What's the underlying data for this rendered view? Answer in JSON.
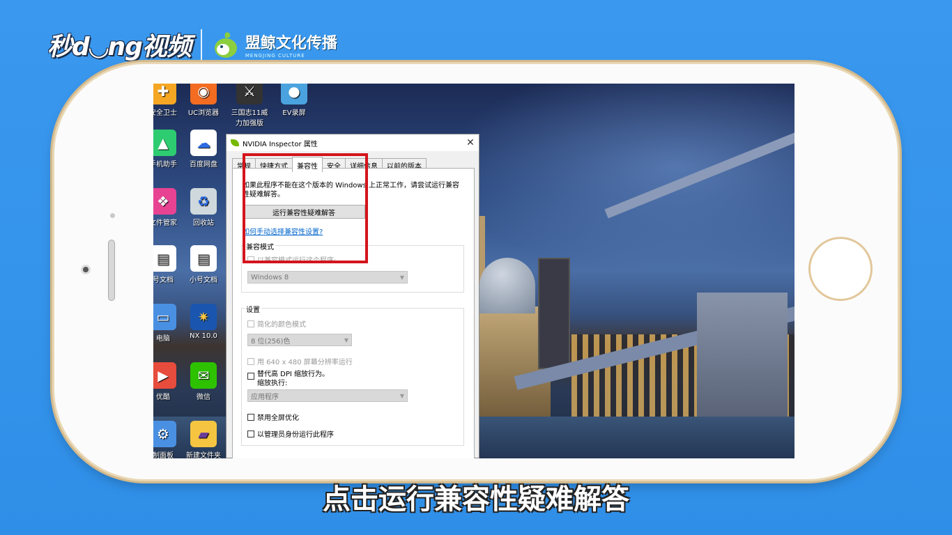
{
  "brand": {
    "logo_text": "秒d◡ng视频",
    "company_name": "盟鲸文化传播",
    "company_sub": "MENGJING CULTURE"
  },
  "desktop_icons": [
    {
      "label": "安全卫士",
      "icon": "shield-icon",
      "color": "#f5a623"
    },
    {
      "label": "UC浏览器",
      "icon": "uc-browser-icon",
      "color": "#f36c21"
    },
    {
      "label": "三国志11威力加强版",
      "icon": "game-pk-icon",
      "color": "#333333"
    },
    {
      "label": "EV录屏",
      "icon": "ev-recorder-icon",
      "color": "#4aa3df"
    },
    {
      "label": "手机助手",
      "icon": "phone-assistant-icon",
      "color": "#2ecc71"
    },
    {
      "label": "百度网盘",
      "icon": "baidu-cloud-icon",
      "color": "#2d6be4"
    },
    {
      "label": "文件管家",
      "icon": "file-manager-icon",
      "color": "#e84393"
    },
    {
      "label": "回收站",
      "icon": "recycle-bin-icon",
      "color": "#cfd8dc"
    },
    {
      "label": "号文档",
      "icon": "document-icon",
      "color": "#ffffff"
    },
    {
      "label": "小号文档",
      "icon": "document-icon",
      "color": "#ffffff"
    },
    {
      "label": "电脑",
      "icon": "computer-icon",
      "color": "#4a90e2"
    },
    {
      "label": "NX 10.0",
      "icon": "nx-icon",
      "color": "#e74c3c"
    },
    {
      "label": "优酷",
      "icon": "video-icon",
      "color": "#e74c3c"
    },
    {
      "label": "微信",
      "icon": "wechat-icon",
      "color": "#2dc100"
    },
    {
      "label": "制面板",
      "icon": "control-panel-icon",
      "color": "#4a90e2"
    },
    {
      "label": "新建文件夹",
      "icon": "folder-icon",
      "color": "#f5c542"
    }
  ],
  "dialog": {
    "title": "NVIDIA Inspector 属性",
    "close_glyph": "✕",
    "tabs": [
      "常规",
      "快捷方式",
      "兼容性",
      "安全",
      "详细信息",
      "以前的版本"
    ],
    "active_tab_index": 2,
    "intro_text": "如果此程序不能在这个版本的 Windows 上正常工作，请尝试运行兼容性疑难解答。",
    "run_button": "运行兼容性疑难解答",
    "manual_link": "如何手动选择兼容性设置?",
    "compat_mode": {
      "group_label": "兼容模式",
      "checkbox_label": "以兼容模式运行这个程序:",
      "select_value": "Windows 8"
    },
    "settings": {
      "group_label": "设置",
      "reduced_color": "简化的颜色模式",
      "color_select": "8 位(256)色",
      "res_640": "用 640 x 480 屏幕分辨率运行",
      "dpi_override": "替代高 DPI 缩放行为。",
      "dpi_sub": "缩放执行:",
      "dpi_select": "应用程序",
      "disable_fullscreen": "禁用全屏优化",
      "run_as_admin": "以管理员身份运行此程序"
    }
  },
  "subtitle": "点击运行兼容性疑难解答",
  "colors": {
    "background": "#3a98ee",
    "highlight_box": "#d4141c",
    "link": "#0066cc"
  }
}
